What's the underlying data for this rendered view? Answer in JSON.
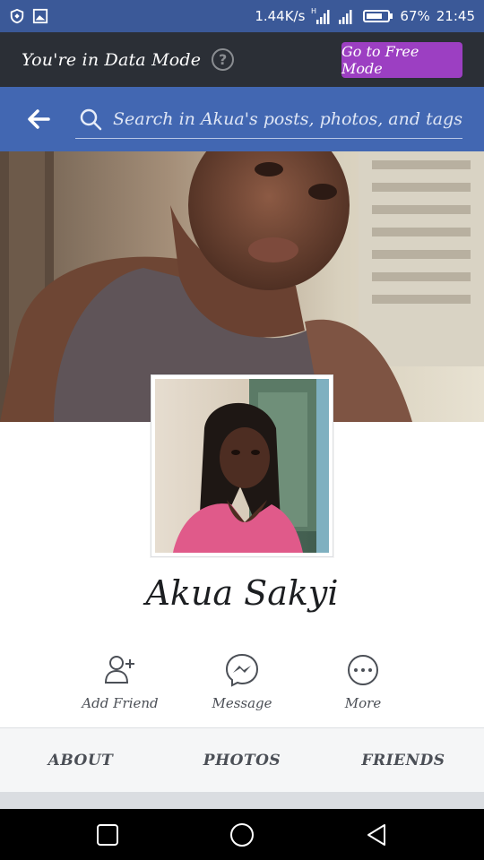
{
  "status_bar": {
    "network_speed": "1.44K/s",
    "network_type": "H",
    "battery": "67%",
    "time": "21:45",
    "icons": [
      "shield-icon",
      "gallery-icon",
      "signal-icon",
      "battery-icon"
    ]
  },
  "data_mode_banner": {
    "message": "You're in Data Mode",
    "help_icon": "question-icon",
    "free_mode_button": "Go to Free Mode",
    "button_color": "#9c3fc2"
  },
  "search_header": {
    "back_icon": "back-arrow-icon",
    "search_icon": "search-icon",
    "placeholder": "Search in Akua's posts, photos, and tags",
    "color": "#4267b2"
  },
  "profile": {
    "name": "Akua Sakyi",
    "actions": [
      {
        "label": "Add Friend",
        "icon": "add-friend-icon"
      },
      {
        "label": "Message",
        "icon": "messenger-icon"
      },
      {
        "label": "More",
        "icon": "more-icon"
      }
    ],
    "tabs": [
      "ABOUT",
      "PHOTOS",
      "FRIENDS"
    ]
  },
  "nav_bar": {
    "icons": [
      "recent-apps-icon",
      "home-icon",
      "back-icon"
    ]
  }
}
